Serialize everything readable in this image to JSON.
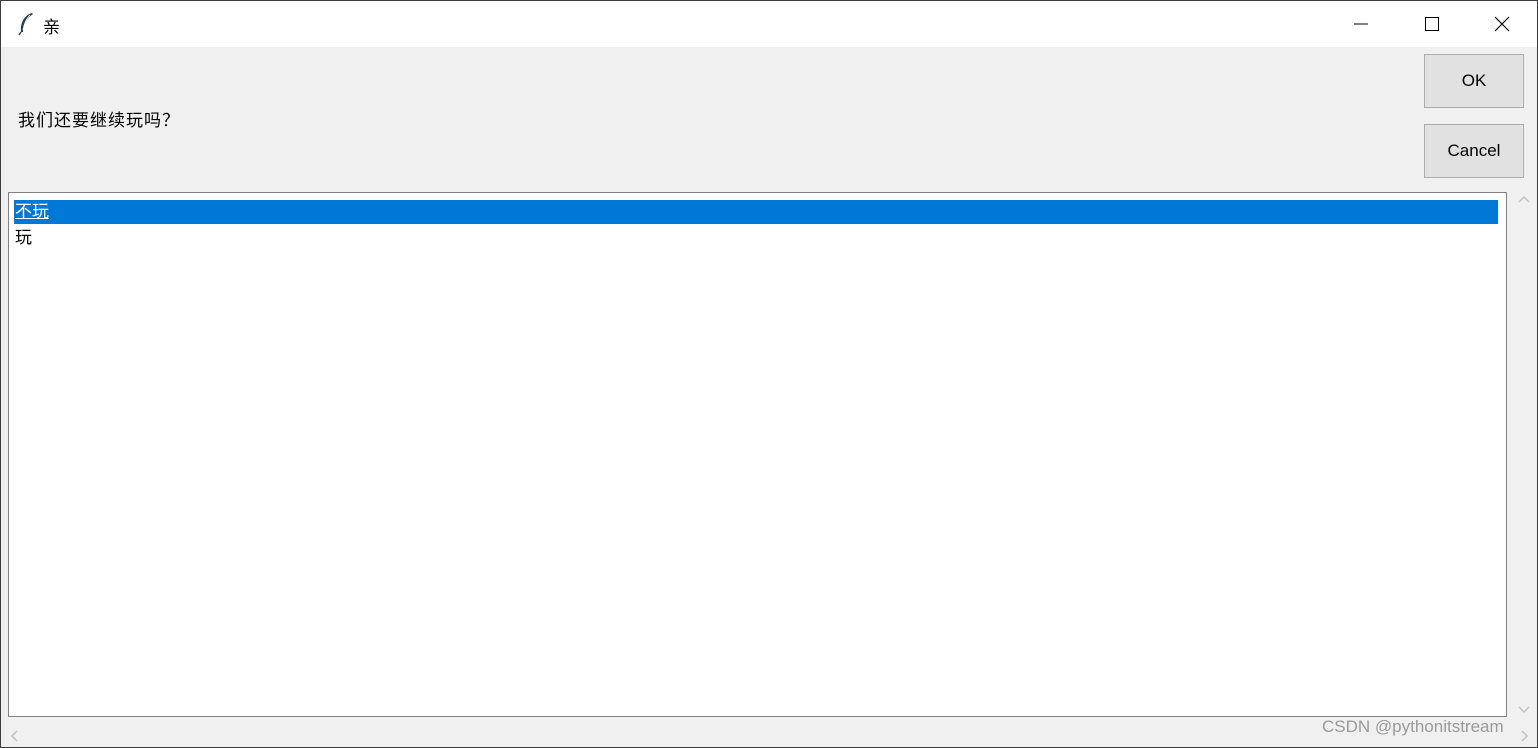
{
  "window": {
    "title": "亲",
    "icon": "feather-icon"
  },
  "controls": {
    "minimize_icon": "minimize-icon",
    "maximize_icon": "maximize-icon",
    "close_icon": "close-icon"
  },
  "dialog": {
    "prompt": "我们还要继续玩吗？",
    "ok_label": "OK",
    "cancel_label": "Cancel"
  },
  "listbox": {
    "items": [
      {
        "label": "不玩",
        "selected": true
      },
      {
        "label": "玩",
        "selected": false
      }
    ]
  },
  "colors": {
    "selection": "#0078d7",
    "background": "#f0f0f0",
    "list_background": "#ffffff"
  },
  "watermark": "CSDN @pythonitstream"
}
